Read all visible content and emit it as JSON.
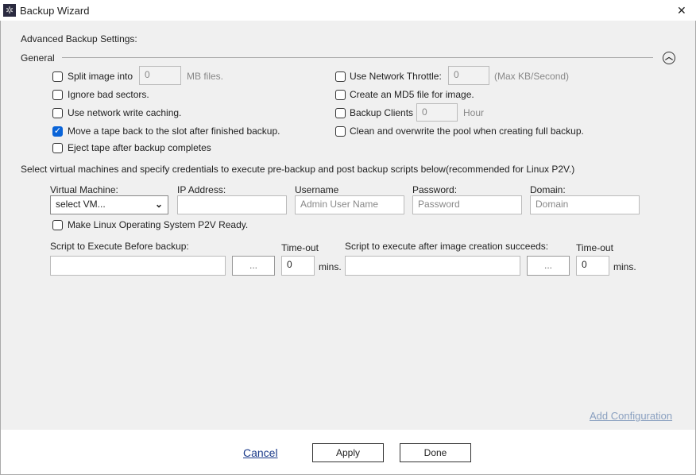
{
  "window": {
    "title": "Backup Wizard",
    "close": "✕"
  },
  "heading": "Advanced Backup Settings:",
  "general": {
    "label": "General",
    "collapse_icon": "chevron-up-circle"
  },
  "left_options": [
    {
      "label": "Split image into",
      "checked": false,
      "value": "0",
      "suffix": "MB files."
    },
    {
      "label": "Ignore bad sectors.",
      "checked": false
    },
    {
      "label": "Use network write caching.",
      "checked": false
    },
    {
      "label": "Move a tape back to the slot after finished backup.",
      "checked": true
    },
    {
      "label": "Eject tape after backup completes",
      "checked": false
    }
  ],
  "right_options": [
    {
      "label": "Use Network Throttle:",
      "checked": false,
      "value": "0",
      "suffix": "(Max KB/Second)"
    },
    {
      "label": "Create an MD5 file for image.",
      "checked": false
    },
    {
      "label": "Backup Clients",
      "checked": false,
      "value": "0",
      "suffix": "Hour"
    },
    {
      "label": "Clean and overwrite the pool when creating full backup.",
      "checked": false
    }
  ],
  "vm_section": {
    "instructions": "Select virtual machines and specify credentials to execute pre-backup and post backup scripts below(recommended for Linux P2V.)",
    "vm_label": "Virtual Machine:",
    "vm_value": "select VM...",
    "ip_label": "IP Address:",
    "ip_value": "",
    "username_label": "Username",
    "username_placeholder": "Admin User Name",
    "password_label": "Password:",
    "password_placeholder": "Password",
    "domain_label": "Domain:",
    "domain_placeholder": "Domain",
    "linux_p2v": {
      "label": "Make Linux Operating System P2V Ready.",
      "checked": false
    }
  },
  "scripts": {
    "before_label": "Script to Execute Before backup:",
    "before_value": "",
    "browse": "...",
    "timeout_label": "Time-out",
    "before_timeout": "0",
    "mins": "mins.",
    "after_label": "Script to execute after image creation succeeds:",
    "after_value": "",
    "after_timeout": "0"
  },
  "add_configuration": "Add Configuration",
  "footer": {
    "cancel": "Cancel",
    "apply": "Apply",
    "done": "Done"
  }
}
